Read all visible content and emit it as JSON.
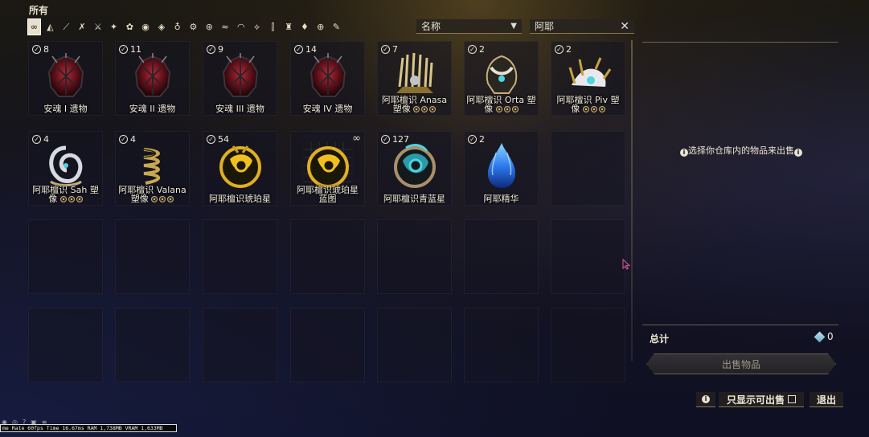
{
  "category": {
    "title": "所有",
    "buttons": [
      {
        "name": "all-icon",
        "glyph": "∞"
      },
      {
        "name": "warframe-icon",
        "glyph": "◭"
      },
      {
        "name": "primary-weapon-icon",
        "glyph": "⟋"
      },
      {
        "name": "secondary-weapon-icon",
        "glyph": "✗"
      },
      {
        "name": "melee-icon",
        "glyph": "⚔"
      },
      {
        "name": "archwing-icon",
        "glyph": "✦"
      },
      {
        "name": "companion-icon",
        "glyph": "✿"
      },
      {
        "name": "sentinel-icon",
        "glyph": "◉"
      },
      {
        "name": "mod-icon",
        "glyph": "◈"
      },
      {
        "name": "key-icon",
        "glyph": "♁"
      },
      {
        "name": "arcane-icon",
        "glyph": "⚙"
      },
      {
        "name": "resource-icon",
        "glyph": "⊛"
      },
      {
        "name": "fish-icon",
        "glyph": "≈"
      },
      {
        "name": "gem-icon",
        "glyph": "◠"
      },
      {
        "name": "blueprint-icon",
        "glyph": "⟡"
      },
      {
        "name": "tower-icon",
        "glyph": "⫿"
      },
      {
        "name": "figure-icon",
        "glyph": "♜"
      },
      {
        "name": "bottle-icon",
        "glyph": "♦"
      },
      {
        "name": "relic-icon",
        "glyph": "⊕"
      },
      {
        "name": "misc-icon",
        "glyph": "✎"
      }
    ]
  },
  "sort": {
    "value": "名称",
    "arrow": "▼"
  },
  "search": {
    "value": "阿耶",
    "clear": "✕"
  },
  "items": [
    {
      "count": "8",
      "label": "安魂 I 遗物",
      "pips": 0,
      "art": "relic",
      "owned": true
    },
    {
      "count": "11",
      "label": "安魂 II 遗物",
      "pips": 0,
      "art": "relic",
      "owned": true
    },
    {
      "count": "9",
      "label": "安魂 III 遗物",
      "pips": 0,
      "art": "relic",
      "owned": true
    },
    {
      "count": "14",
      "label": "安魂 IV 遗物",
      "pips": 0,
      "art": "relic",
      "owned": true
    },
    {
      "count": "7",
      "label": "阿耶檀识 Anasa 塑像",
      "pips": 3,
      "art": "statue-gold",
      "owned": true
    },
    {
      "count": "2",
      "label": "阿耶檀识 Orta 塑像",
      "pips": 3,
      "art": "statue-dark",
      "owned": true
    },
    {
      "count": "2",
      "label": "阿耶檀识 Piv 塑像",
      "pips": 3,
      "art": "statue-white",
      "owned": true
    },
    {
      "count": "4",
      "label": "阿耶檀识 Sah 塑像",
      "pips": 3,
      "art": "statue-swirl",
      "owned": true
    },
    {
      "count": "4",
      "label": "阿耶檀识 Valana 塑像",
      "pips": 3,
      "art": "statue-coil",
      "owned": true
    },
    {
      "count": "54",
      "label": "阿耶檀识琥珀星",
      "pips": 0,
      "art": "amber-star",
      "owned": true
    },
    {
      "count": "",
      "label": "阿耶檀识琥珀星 蓝图",
      "pips": 0,
      "art": "amber-blueprint",
      "owned": false,
      "infinite": "∞"
    },
    {
      "count": "127",
      "label": "阿耶檀识青蓝星",
      "pips": 0,
      "art": "cyan-star",
      "owned": true
    },
    {
      "count": "2",
      "label": "阿耶精华",
      "pips": 0,
      "art": "essence",
      "owned": true
    }
  ],
  "panel": {
    "hint": "选择你仓库内的物品来出售",
    "total_label": "总计",
    "total_value": "0",
    "sell_button": "出售物品"
  },
  "bottom": {
    "info_label": "i",
    "sellable_only": "只显示可出售",
    "exit": "退出"
  },
  "perf_overlay": "me Rate 60fps Time 16.67ms RAM 1,738MB VRAM 1,633MB",
  "colors": {
    "accent_gold": "#c8b07a",
    "text": "#f0ead8",
    "relic_red": "#7a1e22",
    "cyan": "#4fd3e0",
    "essence_blue": "#2f7cf0"
  }
}
